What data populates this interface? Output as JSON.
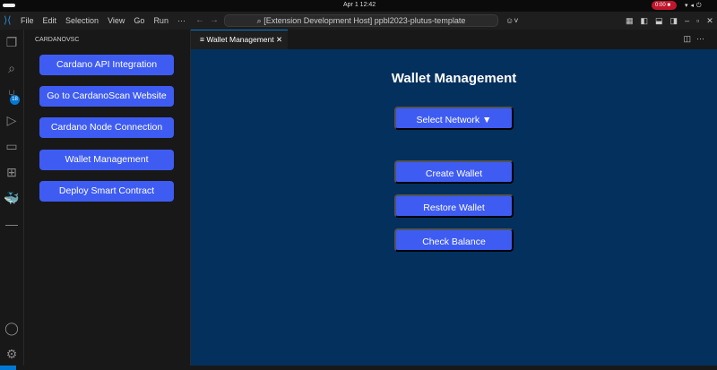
{
  "system": {
    "clock": "Apr 1  12:42",
    "recording": "0:00"
  },
  "titlebar": {
    "menu": [
      "File",
      "Edit",
      "Selection",
      "View",
      "Go",
      "Run",
      "···"
    ],
    "command_center": "[Extension Development Host] ppbl2023-plutus-template"
  },
  "activity": {
    "scm_badge": "18"
  },
  "sidebar": {
    "header": "CARDANOVSC",
    "buttons": [
      "Cardano API Integration",
      "Go to CardanoScan Website",
      "Cardano Node Connection",
      "Wallet Management",
      "Deploy Smart Contract"
    ]
  },
  "tab": {
    "label": "Wallet Management"
  },
  "webview": {
    "title": "Wallet Management",
    "select_network": "Select Network ▼",
    "buttons": [
      "Create Wallet",
      "Restore Wallet",
      "Check Balance"
    ]
  },
  "colors": {
    "button": "#3f5cf2",
    "webview_bg": "#04305e",
    "accent": "#0078d4"
  }
}
